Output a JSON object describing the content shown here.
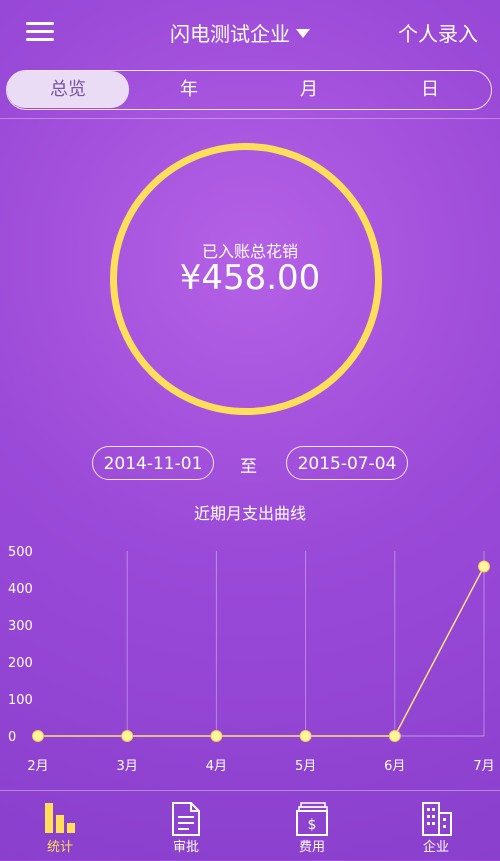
{
  "header": {
    "company_name": "闪电测试企业",
    "personal_entry": "个人录入"
  },
  "tabs": [
    {
      "label": "总览",
      "active": true
    },
    {
      "label": "年",
      "active": false
    },
    {
      "label": "月",
      "active": false
    },
    {
      "label": "日",
      "active": false
    }
  ],
  "summary": {
    "label": "已入账总花销",
    "amount": "¥458.00"
  },
  "date_range": {
    "start": "2014-11-01",
    "separator": "至",
    "end": "2015-07-04"
  },
  "chart_data": {
    "type": "line",
    "title": "近期月支出曲线",
    "categories": [
      "2月",
      "3月",
      "4月",
      "5月",
      "6月",
      "7月"
    ],
    "values": [
      0,
      0,
      0,
      0,
      0,
      458
    ],
    "ylim": [
      0,
      500
    ],
    "yticks": [
      0,
      100,
      200,
      300,
      400,
      500
    ],
    "grid": "vertical",
    "line_color": "#ffe27a",
    "point_color": "#fff59a"
  },
  "bottom_nav": [
    {
      "label": "统计",
      "icon": "bar-chart-icon",
      "active": true
    },
    {
      "label": "审批",
      "icon": "document-icon",
      "active": false
    },
    {
      "label": "费用",
      "icon": "money-icon",
      "active": false
    },
    {
      "label": "企业",
      "icon": "building-icon",
      "active": false
    }
  ],
  "colors": {
    "accent": "#ffdf5a",
    "background": "#9b4ad8"
  }
}
